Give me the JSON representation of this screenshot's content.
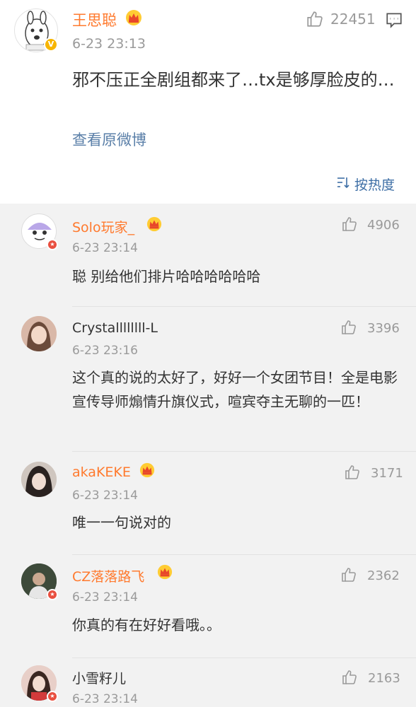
{
  "main_post": {
    "author": "王思聪",
    "time": "6-23 23:13",
    "likes": "22451",
    "text": "邪不压正全剧组都来了…tx是够厚脸皮的…",
    "view_original": "查看原微博",
    "sort_label": "按热度"
  },
  "comments": [
    {
      "name": "Solo玩家_",
      "time": "6-23 23:14",
      "likes": "4906",
      "text": "聪 别给他们排片哈哈哈哈哈哈"
    },
    {
      "name": "Crystallllllll-L",
      "time": "6-23 23:16",
      "likes": "3396",
      "text": "这个真的说的太好了，好好一个女团节目！全是电影宣传导师煽情升旗仪式，喧宾夺主无聊的一匹！"
    },
    {
      "name": "akaKEKE",
      "time": "6-23 23:14",
      "likes": "3171",
      "text": "唯一一句说对的"
    },
    {
      "name": "CZ落落路飞",
      "time": "6-23 23:14",
      "likes": "2362",
      "text": "你真的有在好好看哦。。"
    },
    {
      "name": "小雪籽儿",
      "time": "6-23 23:14",
      "likes": "2163",
      "text": ""
    }
  ],
  "colors": {
    "vip_name": "#ff7a2e",
    "link": "#5a7fa8",
    "sort": "#3d6ea5",
    "meta": "#9a9a9a"
  },
  "icons": [
    "thumbs-up-icon",
    "comment-icon",
    "crown-icon",
    "verified-icon",
    "sort-icon"
  ]
}
